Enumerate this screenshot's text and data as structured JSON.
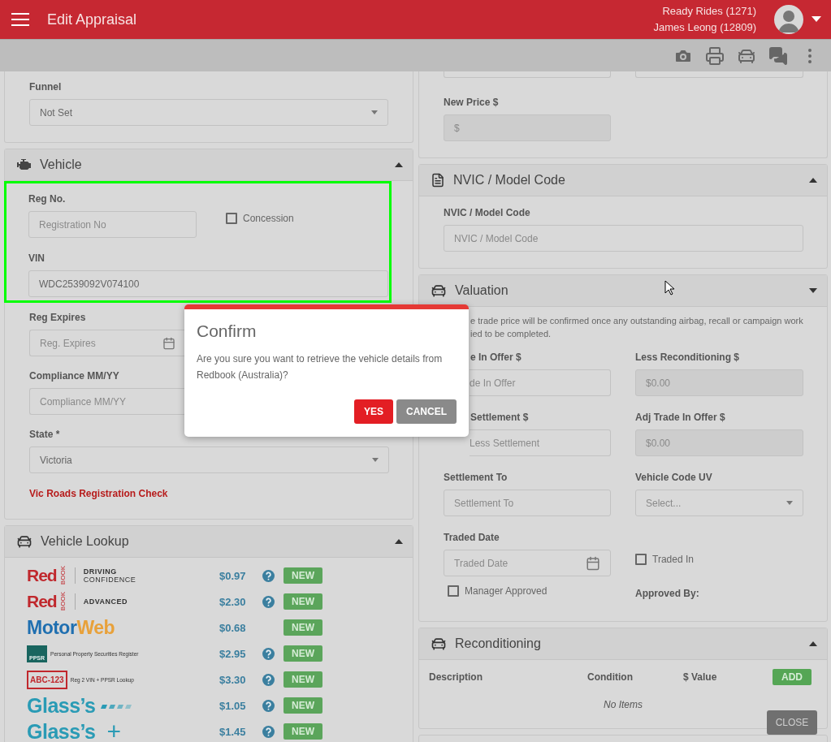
{
  "app_bar": {
    "title": "Edit Appraisal",
    "dealer": "Ready Rides (1271)",
    "user": "James Leong (12809)"
  },
  "funnel": {
    "label": "Funnel",
    "value": "Not Set"
  },
  "vehicle": {
    "title": "Vehicle",
    "expanded": true,
    "reg_label": "Reg No.",
    "reg_placeholder": "Registration No",
    "concession": {
      "label": "Concession",
      "checked": false
    },
    "vin_label": "VIN",
    "vin_value": "WDC2539092V074100",
    "reg_expires": {
      "label": "Reg Expires",
      "placeholder": "Reg. Expires"
    },
    "compliance": {
      "label": "Compliance MM/YY",
      "placeholder": "Compliance MM/YY"
    },
    "state": {
      "label": "State *",
      "value": "Victoria"
    },
    "link": "Vic Roads Registration Check"
  },
  "lookup": {
    "title": "Vehicle Lookup",
    "expanded": true,
    "providers": [
      {
        "kind": "redbook",
        "brand": "Red",
        "tag": "BOOK",
        "product": [
          "DRIVING",
          "CONFIDENCE"
        ],
        "price": "$0.97",
        "help": true,
        "badge": "NEW"
      },
      {
        "kind": "redbook",
        "brand": "Red",
        "tag": "BOOK",
        "product": [
          "ADVANCED"
        ],
        "price": "$2.30",
        "help": true,
        "badge": "NEW"
      },
      {
        "kind": "motorweb",
        "brand": "Motor",
        "tag": "Web",
        "price": "$0.68",
        "help": false,
        "badge": "NEW"
      },
      {
        "kind": "ppsr",
        "brand": "PPSR",
        "tag": "Personal Property Securities Register",
        "price": "$2.95",
        "help": true,
        "badge": "NEW"
      },
      {
        "kind": "plate",
        "brand": "ABC-123",
        "tag": "Reg 2 VIN + PPSR Lookup",
        "price": "$3.30",
        "help": true,
        "badge": "NEW"
      },
      {
        "kind": "glass",
        "brand": "Glass’s",
        "price": "$1.05",
        "help": true,
        "badge": "NEW"
      },
      {
        "kind": "glass",
        "brand": "Glass’s",
        "suffix": "+",
        "price": "$1.45",
        "help": true,
        "badge": "NEW"
      }
    ]
  },
  "new_price": {
    "label": "New Price $",
    "placeholder": "$"
  },
  "nvic": {
    "title": "NVIC / Model Code",
    "expanded": true,
    "label": "NVIC / Model Code",
    "placeholder": "NVIC / Model Code"
  },
  "valuation": {
    "title": "Valuation",
    "expanded": false,
    "note": [
      "e trade price will be confirmed once any outstanding airbag, recall or campaign work",
      "ied to be completed."
    ],
    "fields": [
      {
        "kind": "input",
        "label": "e In Offer $",
        "placeholder": "de In Offer",
        "disabled": false
      },
      {
        "kind": "input",
        "label": "Less Reconditioning $",
        "placeholder": "$0.00",
        "disabled": true
      },
      {
        "kind": "input",
        "label": "Settlement $",
        "placeholder": "Less Settlement",
        "disabled": false
      },
      {
        "kind": "input",
        "label": "Adj Trade In Offer $",
        "placeholder": "$0.00",
        "disabled": true
      },
      {
        "kind": "input",
        "label": "Settlement To",
        "placeholder": "Settlement To",
        "disabled": false
      },
      {
        "kind": "select",
        "label": "Vehicle Code UV",
        "placeholder": "Select..."
      },
      {
        "kind": "date",
        "label": "Traded Date",
        "placeholder": "Traded Date"
      },
      {
        "kind": "checkbox",
        "label": "Traded In",
        "checked": false
      },
      {
        "kind": "checkbox",
        "label": "Manager Approved",
        "checked": false
      },
      {
        "kind": "text",
        "label": "Approved By:"
      }
    ]
  },
  "reconditioning": {
    "title": "Reconditioning",
    "expanded": true,
    "columns": [
      "Description",
      "Condition",
      "$ Value"
    ],
    "add": "ADD",
    "empty": "No Items"
  },
  "modal": {
    "title": "Confirm",
    "message": "Are you sure you want to retrieve the vehicle details from Redbook (Australia)?",
    "confirm": "YES",
    "cancel": "CANCEL"
  },
  "close": "CLOSE"
}
